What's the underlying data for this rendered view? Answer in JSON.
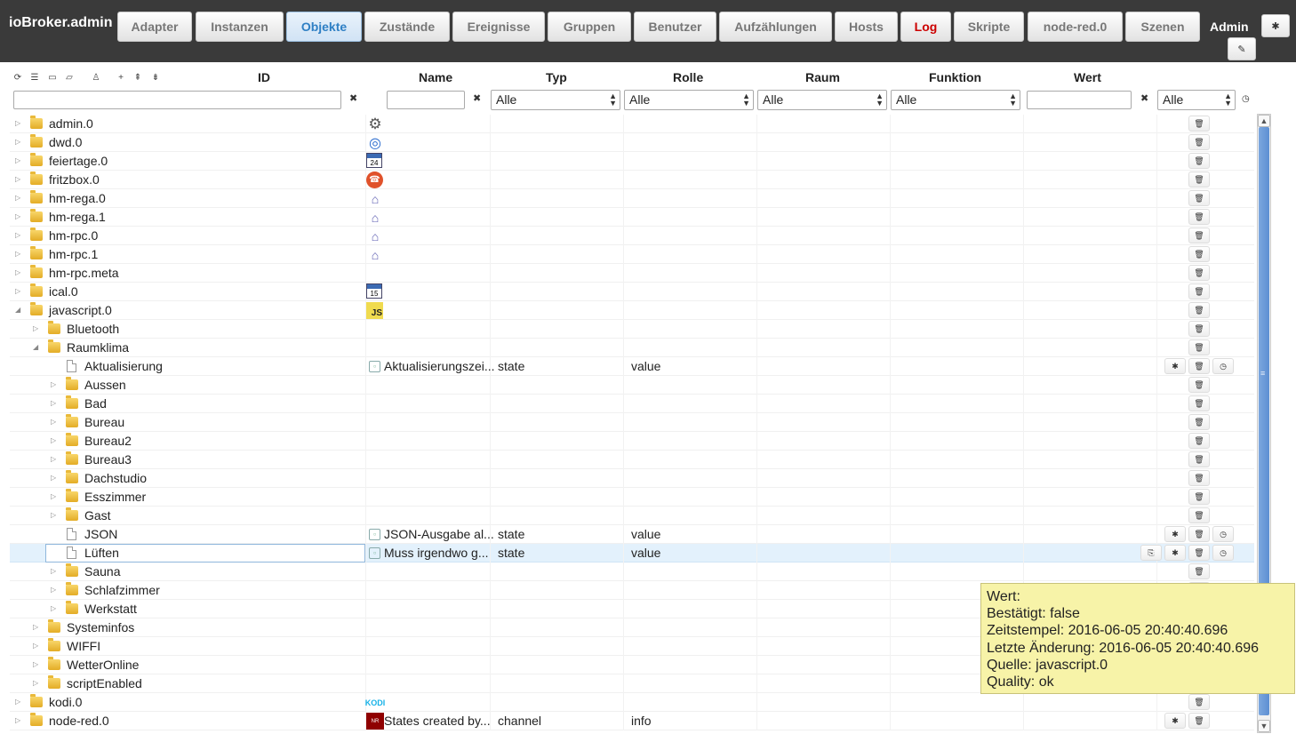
{
  "app": {
    "title": "ioBroker.admin",
    "user": "Admin",
    "tabs": [
      {
        "label": "Adapter",
        "active": false
      },
      {
        "label": "Instanzen",
        "active": false
      },
      {
        "label": "Objekte",
        "active": true
      },
      {
        "label": "Zustände",
        "active": false
      },
      {
        "label": "Ereignisse",
        "active": false
      },
      {
        "label": "Gruppen",
        "active": false
      },
      {
        "label": "Benutzer",
        "active": false
      },
      {
        "label": "Aufzählungen",
        "active": false
      },
      {
        "label": "Hosts",
        "active": false
      },
      {
        "label": "Log",
        "active": false
      },
      {
        "label": "Skripte",
        "active": false
      },
      {
        "label": "node-red.0",
        "active": false
      },
      {
        "label": "Szenen",
        "active": false
      }
    ],
    "settings_icon": "gear-icon",
    "edit_icon": "pencil-icon"
  },
  "columns": {
    "id": "ID",
    "name": "Name",
    "typ": "Typ",
    "rolle": "Rolle",
    "raum": "Raum",
    "funktion": "Funktion",
    "wert": "Wert"
  },
  "filters": {
    "id_value": "",
    "name_value": "",
    "typ_selected": "Alle",
    "rolle_selected": "Alle",
    "raum_selected": "Alle",
    "funktion_selected": "Alle",
    "wert_value": "",
    "ack_selected": "Alle"
  },
  "toolbar_icons": [
    "refresh-icon",
    "list-icon",
    "folder-closed-icon",
    "folder-open-icon",
    "user-icon",
    "add-icon",
    "collapse-all-icon",
    "expand-all-icon"
  ],
  "tree": [
    {
      "label": "admin.0",
      "level": 0,
      "kind": "folder",
      "expander": "collapsed",
      "icon": "gear-icon"
    },
    {
      "label": "dwd.0",
      "level": 0,
      "kind": "folder",
      "expander": "collapsed",
      "icon": "dwd-logo-icon"
    },
    {
      "label": "feiertage.0",
      "level": 0,
      "kind": "folder",
      "expander": "collapsed",
      "icon": "calendar-icon",
      "icon_text": "24"
    },
    {
      "label": "fritzbox.0",
      "level": 0,
      "kind": "folder",
      "expander": "collapsed",
      "icon": "phone-icon"
    },
    {
      "label": "hm-rega.0",
      "level": 0,
      "kind": "folder",
      "expander": "collapsed",
      "icon": "homematic-icon"
    },
    {
      "label": "hm-rega.1",
      "level": 0,
      "kind": "folder",
      "expander": "collapsed",
      "icon": "homematic-icon"
    },
    {
      "label": "hm-rpc.0",
      "level": 0,
      "kind": "folder",
      "expander": "collapsed",
      "icon": "homematic-icon"
    },
    {
      "label": "hm-rpc.1",
      "level": 0,
      "kind": "folder",
      "expander": "collapsed",
      "icon": "homematic-icon"
    },
    {
      "label": "hm-rpc.meta",
      "level": 0,
      "kind": "folder",
      "expander": "collapsed"
    },
    {
      "label": "ical.0",
      "level": 0,
      "kind": "folder",
      "expander": "collapsed",
      "icon": "calendar-icon",
      "icon_text": "15"
    },
    {
      "label": "javascript.0",
      "level": 0,
      "kind": "folder",
      "expander": "expanded",
      "icon": "javascript-icon",
      "icon_text": "JS"
    },
    {
      "label": "Bluetooth",
      "level": 1,
      "kind": "folder",
      "expander": "collapsed"
    },
    {
      "label": "Raumklima",
      "level": 1,
      "kind": "folder",
      "expander": "expanded"
    },
    {
      "label": "Aktualisierung",
      "level": 2,
      "kind": "file",
      "name": "Aktualisierungszei...",
      "typ": "state",
      "rolle": "value",
      "actions": [
        "settings",
        "delete",
        "history"
      ]
    },
    {
      "label": "Aussen",
      "level": 2,
      "kind": "folder",
      "expander": "collapsed"
    },
    {
      "label": "Bad",
      "level": 2,
      "kind": "folder",
      "expander": "collapsed"
    },
    {
      "label": "Bureau",
      "level": 2,
      "kind": "folder",
      "expander": "collapsed"
    },
    {
      "label": "Bureau2",
      "level": 2,
      "kind": "folder",
      "expander": "collapsed"
    },
    {
      "label": "Bureau3",
      "level": 2,
      "kind": "folder",
      "expander": "collapsed"
    },
    {
      "label": "Dachstudio",
      "level": 2,
      "kind": "folder",
      "expander": "collapsed"
    },
    {
      "label": "Esszimmer",
      "level": 2,
      "kind": "folder",
      "expander": "collapsed"
    },
    {
      "label": "Gast",
      "level": 2,
      "kind": "folder",
      "expander": "collapsed"
    },
    {
      "label": "JSON",
      "level": 2,
      "kind": "file",
      "name": "JSON-Ausgabe al...",
      "typ": "state",
      "rolle": "value",
      "actions": [
        "settings",
        "delete",
        "history"
      ]
    },
    {
      "label": "Lüften",
      "level": 2,
      "kind": "file",
      "selected": true,
      "name": "Muss irgendwo g...",
      "typ": "state",
      "rolle": "value",
      "actions": [
        "copy",
        "settings",
        "delete",
        "history"
      ]
    },
    {
      "label": "Sauna",
      "level": 2,
      "kind": "folder",
      "expander": "collapsed"
    },
    {
      "label": "Schlafzimmer",
      "level": 2,
      "kind": "folder",
      "expander": "collapsed"
    },
    {
      "label": "Werkstatt",
      "level": 2,
      "kind": "folder",
      "expander": "collapsed"
    },
    {
      "label": "Systeminfos",
      "level": 1,
      "kind": "folder",
      "expander": "collapsed"
    },
    {
      "label": "WIFFI",
      "level": 1,
      "kind": "folder",
      "expander": "collapsed"
    },
    {
      "label": "WetterOnline",
      "level": 1,
      "kind": "folder",
      "expander": "collapsed"
    },
    {
      "label": "scriptEnabled",
      "level": 1,
      "kind": "folder",
      "expander": "collapsed"
    },
    {
      "label": "kodi.0",
      "level": 0,
      "kind": "folder",
      "expander": "collapsed",
      "icon": "kodi-icon",
      "icon_text": "KODI"
    },
    {
      "label": "node-red.0",
      "level": 0,
      "kind": "folder",
      "expander": "collapsed",
      "icon": "node-red-icon",
      "name": "States created by...",
      "typ": "channel",
      "rolle": "info",
      "actions": [
        "settings",
        "delete"
      ]
    }
  ],
  "tooltip": {
    "lines": [
      "Wert:",
      "Bestätigt: false",
      "Zeitstempel: 2016-06-05 20:40:40.696",
      "Letzte Änderung: 2016-06-05 20:40:40.696",
      "Quelle: javascript.0",
      "Quality: ok"
    ]
  },
  "colors": {
    "topbar": "#3a3a3a",
    "active_tab_text": "#2e7fc4",
    "log_tab_text": "#cc0000",
    "tooltip_bg": "#f7f3a8",
    "selected_row": "#e3f1fc",
    "scroll_thumb": "#5d8fd2"
  }
}
